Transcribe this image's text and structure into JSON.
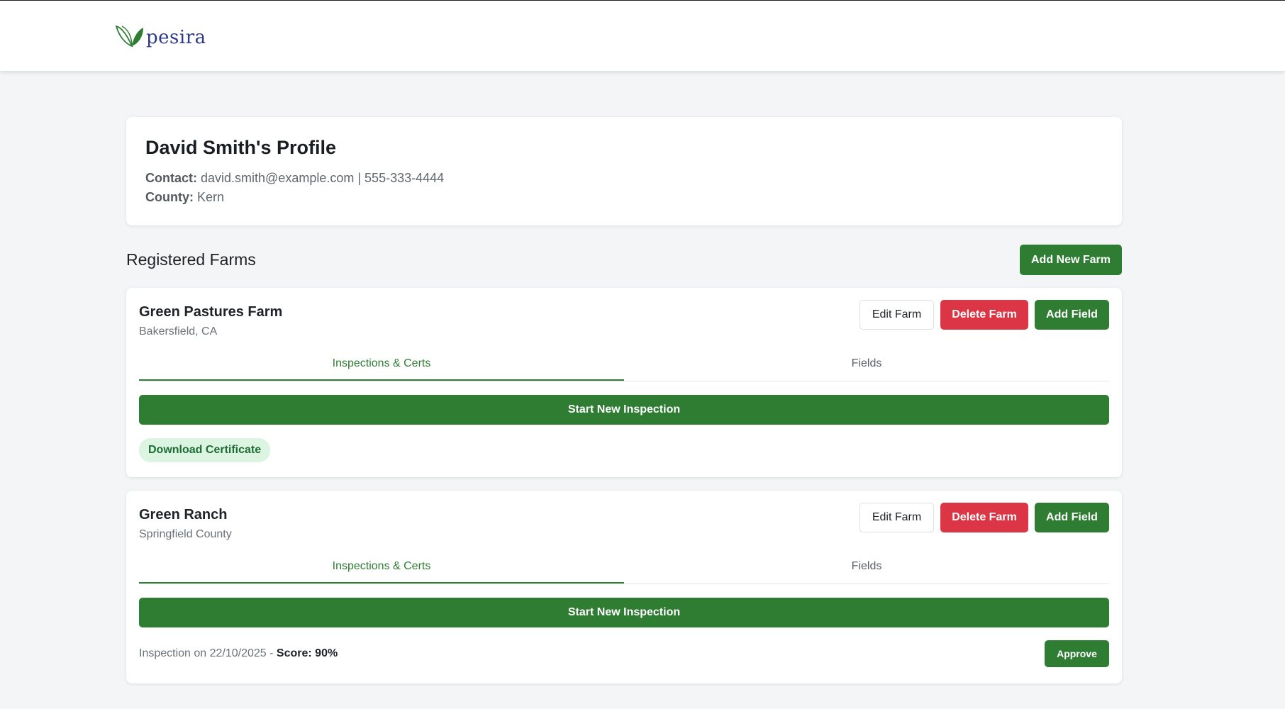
{
  "header": {
    "logo_text": "pesira",
    "logo_icon": "leaf-logo-icon",
    "brand_color": "#2e7d32"
  },
  "profile": {
    "title": "David Smith's Profile",
    "contact_label": "Contact:",
    "contact_value": "david.smith@example.com | 555-333-4444",
    "county_label": "County:",
    "county_value": "Kern"
  },
  "farms_section": {
    "title": "Registered Farms",
    "add_button": "Add New Farm"
  },
  "farms": [
    {
      "name": "Green Pastures Farm",
      "location": "Bakersfield, CA",
      "edit_label": "Edit Farm",
      "delete_label": "Delete Farm",
      "add_field_label": "Add Field",
      "tabs": [
        "Inspections & Certs",
        "Fields"
      ],
      "active_tab": "Inspections & Certs",
      "start_inspection_label": "Start New Inspection",
      "certificate_label": "Download Certificate"
    },
    {
      "name": "Green Ranch",
      "location": "Springfield County",
      "edit_label": "Edit Farm",
      "delete_label": "Delete Farm",
      "add_field_label": "Add Field",
      "tabs": [
        "Inspections & Certs",
        "Fields"
      ],
      "active_tab": "Inspections & Certs",
      "start_inspection_label": "Start New Inspection",
      "inspection_text": "Inspection on 22/10/2025 - ",
      "inspection_score": "Score: 90%",
      "approve_label": "Approve"
    }
  ],
  "colors": {
    "green": "#2e7d32",
    "red": "#dc3545",
    "badge_bg": "#dcf5e3"
  }
}
